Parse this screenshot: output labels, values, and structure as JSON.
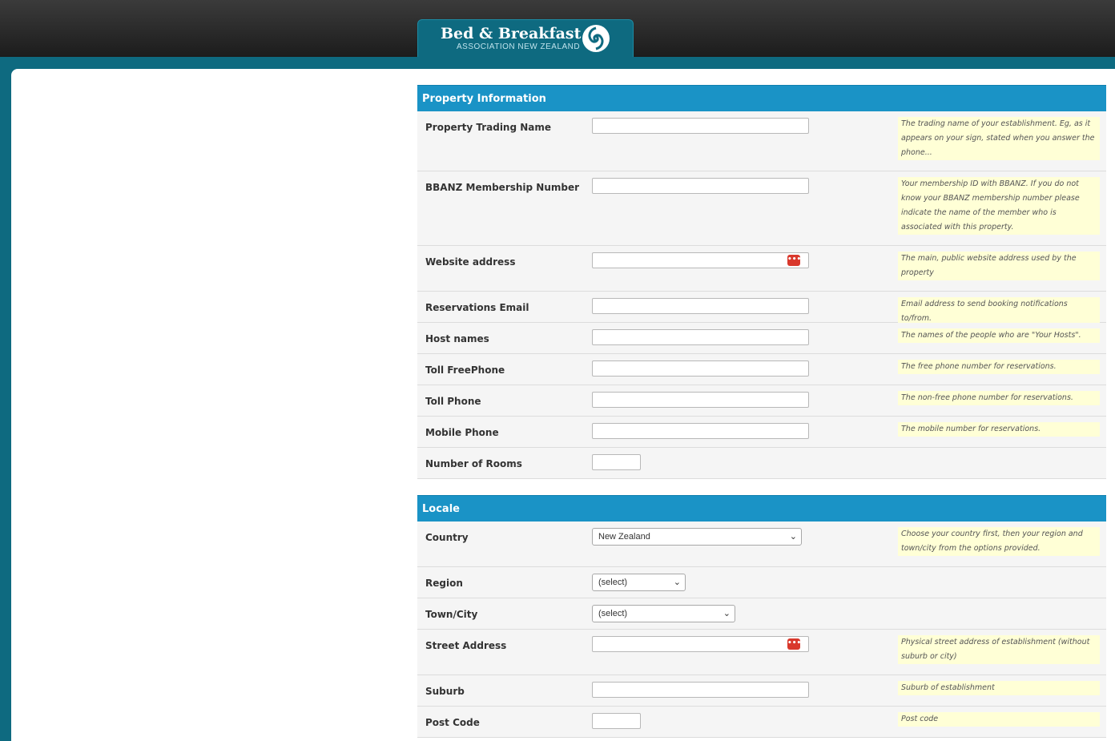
{
  "header": {
    "logo_title": "Bed & Breakfast",
    "logo_subtitle": "ASSOCIATION NEW ZEALAND",
    "logo_icon": "fern-koru-icon"
  },
  "sections": [
    {
      "title": "Property Information",
      "rows": [
        {
          "label": "Property Trading Name",
          "field": "text",
          "help": "The trading name of your establishment. Eg, as it appears on your sign, stated when you answer the phone..."
        },
        {
          "label": "BBANZ Membership Number",
          "field": "text",
          "help": "Your membership ID with BBANZ. If you do not know your BBANZ membership number please indicate the name of the member who is associated with this property."
        },
        {
          "label": "Website address",
          "field": "text",
          "badge": "•••",
          "help": "The main, public website address used by the property"
        },
        {
          "label": "Reservations Email",
          "field": "text",
          "help": "Email address to send booking notifications to/from."
        },
        {
          "label": "Host names",
          "field": "text",
          "help": "The names of the people who are \"Your Hosts\"."
        },
        {
          "label": "Toll FreePhone",
          "field": "text",
          "help": "The free phone number for reservations."
        },
        {
          "label": "Toll Phone",
          "field": "text",
          "help": "The non-free phone number for reservations."
        },
        {
          "label": "Mobile Phone",
          "field": "text",
          "help": "The mobile number for reservations."
        },
        {
          "label": "Number of Rooms",
          "field": "small"
        }
      ]
    },
    {
      "title": "Locale",
      "rows": [
        {
          "label": "Country",
          "field": "select",
          "value": "New Zealand",
          "help": "Choose your country first, then your region and town/city from the options provided."
        },
        {
          "label": "Region",
          "field": "select",
          "value": "(select)"
        },
        {
          "label": "Town/City",
          "field": "select",
          "value": "(select)"
        },
        {
          "label": "Street Address",
          "field": "text",
          "badge": "•••",
          "help": "Physical street address of establishment (without suburb or city)"
        },
        {
          "label": "Suburb",
          "field": "text",
          "help": "Suburb of establishment"
        },
        {
          "label": "Post Code",
          "field": "small",
          "help": "Post code"
        }
      ]
    }
  ]
}
